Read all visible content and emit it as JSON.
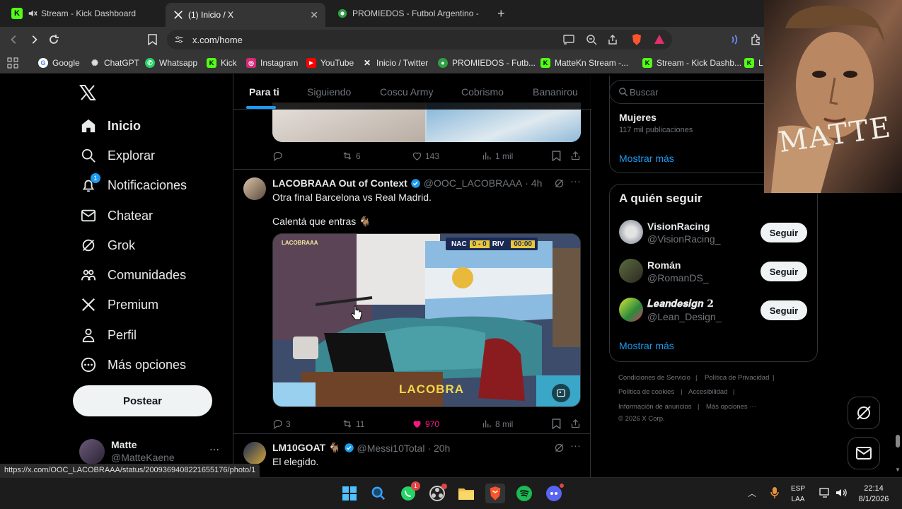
{
  "browser": {
    "tabs": [
      {
        "title": "Stream - Kick Dashboard",
        "active": false
      },
      {
        "title": "(1) Inicio / X",
        "active": true
      },
      {
        "title": "PROMIEDOS - Futbol Argentino - Fixt",
        "active": false
      }
    ],
    "new_tab_label": "+",
    "url": "x.com/home",
    "bookmarks": [
      {
        "label": "Google",
        "color": "#4285f4"
      },
      {
        "label": "ChatGPT",
        "color": "#cfcfcf"
      },
      {
        "label": "Whatsapp",
        "color": "#25d366"
      },
      {
        "label": "Kick",
        "color": "#53fc18"
      },
      {
        "label": "Instagram",
        "color": "#d62976"
      },
      {
        "label": "YouTube",
        "color": "#ff0000"
      },
      {
        "label": "Inicio / Twitter",
        "color": "#ffffff"
      },
      {
        "label": "PROMIEDOS - Futb...",
        "color": "#2ea043"
      },
      {
        "label": "MatteKn Stream -...",
        "color": "#53fc18"
      },
      {
        "label": "Stream - Kick Dashb...",
        "color": "#53fc18"
      },
      {
        "label": "L",
        "color": "#53fc18"
      }
    ],
    "status_url": "https://x.com/OOC_LACOBRAAA/status/2009369408221655176/photo/1"
  },
  "nav": {
    "items": [
      {
        "label": "Inicio",
        "icon": "home-icon"
      },
      {
        "label": "Explorar",
        "icon": "search-icon"
      },
      {
        "label": "Notificaciones",
        "icon": "bell-icon"
      },
      {
        "label": "Chatear",
        "icon": "mail-icon"
      },
      {
        "label": "Grok",
        "icon": "grok-icon"
      },
      {
        "label": "Comunidades",
        "icon": "communities-icon"
      },
      {
        "label": "Premium",
        "icon": "x-logo-icon"
      },
      {
        "label": "Perfil",
        "icon": "person-icon"
      },
      {
        "label": "Más opciones",
        "icon": "more-circle-icon"
      }
    ],
    "notification_badge": "1",
    "post_button": "Postear",
    "account": {
      "name": "Matte",
      "handle": "@MatteKaene",
      "more": "···"
    }
  },
  "feed": {
    "tabs": [
      "Para ti",
      "Siguiendo",
      "Coscu Army",
      "Cobrismo",
      "Bananirou"
    ],
    "prev_tweet_actions": {
      "reposts": "6",
      "likes": "143",
      "views": "1 mil"
    },
    "tweet": {
      "name": "LACOBRAAA Out of Context",
      "handle": "@OOC_LACOBRAAA",
      "time": "· 4h",
      "line1": "Otra final Barcelona vs Real Madrid.",
      "line2": "Calentá que entras 🐐",
      "media": {
        "watermark": "LACOBRAAA",
        "score_home": "NAC",
        "score": "0 - 0",
        "score_away": "RIV",
        "clock": "00:00",
        "caption": "LACOBRA"
      },
      "replies": "3",
      "reposts": "11",
      "likes": "970",
      "views": "8 mil"
    },
    "next_tweet": {
      "name": "LM10GOAT 🐐",
      "handle": "@Messi10Total",
      "time": "· 20h",
      "text": "El elegido."
    }
  },
  "sidebar": {
    "search_placeholder": "Buscar",
    "trend": {
      "topic": "Mujeres",
      "count": "117 mil publicaciones",
      "show_more": "Mostrar más"
    },
    "who_to_follow": {
      "title": "A quién seguir",
      "users": [
        {
          "name": "VisionRacing",
          "handle": "@VisionRacing_",
          "button": "Seguir"
        },
        {
          "name": "Román",
          "handle": "@RomanDS_",
          "button": "Seguir"
        },
        {
          "name": "𝑳𝒆𝒂𝒏𝒅𝒆𝒔𝒊𝒈𝒏 2",
          "handle": "@Lean_Design_",
          "button": "Seguir"
        }
      ],
      "show_more": "Mostrar más"
    },
    "footer": {
      "terms": "Condiciones de Servicio",
      "privacy": "Política de Privacidad",
      "cookies": "Política de cookies",
      "accessibility": "Accesibilidad",
      "ads": "Información de anuncios",
      "more": "Más opciones ···",
      "copyright": "© 2026 X Corp."
    }
  },
  "overlay": {
    "text": "MATTE"
  },
  "taskbar": {
    "lang_top": "ESP",
    "lang_bottom": "LAA",
    "time": "22:14",
    "date": "8/1/2026",
    "whatsapp_badge": "1"
  }
}
